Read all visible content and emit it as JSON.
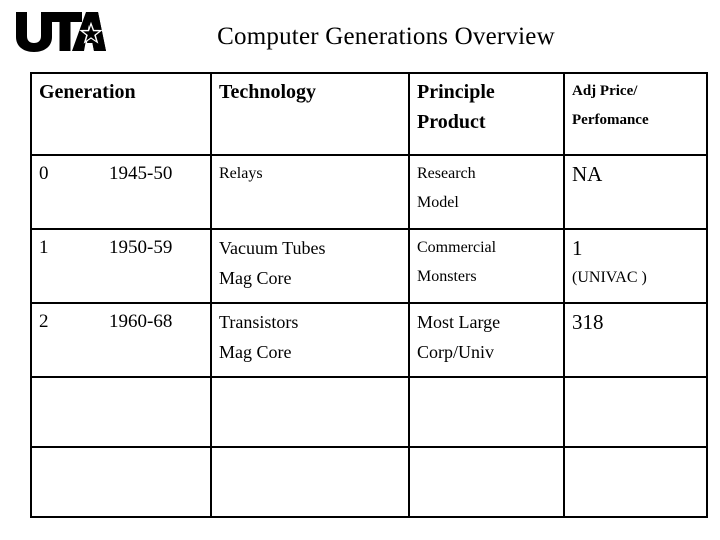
{
  "header": {
    "logo_text": "UTA",
    "logo_icon": "uta-star-logo",
    "title": "Computer Generations Overview"
  },
  "table": {
    "columns": [
      {
        "key": "generation",
        "label": "Generation",
        "size": "big"
      },
      {
        "key": "technology",
        "label": "Technology",
        "size": "big"
      },
      {
        "key": "principle_product",
        "label_line1": "Principle",
        "label_line2": "Product",
        "size": "big"
      },
      {
        "key": "adj_price_performance",
        "label_line1": "Adj Price/",
        "label_line2": "Perfomance",
        "size": "small"
      }
    ],
    "rows": [
      {
        "generation_number": "0",
        "generation_years": "1945-50",
        "technology_line1": "Relays",
        "technology_line2": "",
        "principle_line1": "Research",
        "principle_line2": "Model",
        "price_line1": "NA",
        "price_line2": ""
      },
      {
        "generation_number": "1",
        "generation_years": "1950-59",
        "technology_line1": "Vacuum Tubes",
        "technology_line2": "Mag Core",
        "principle_line1": "Commercial",
        "principle_line2": "Monsters",
        "price_line1": "1",
        "price_line2": "(UNIVAC )"
      },
      {
        "generation_number": "2",
        "generation_years": "1960-68",
        "technology_line1": "Transistors",
        "technology_line2": "Mag Core",
        "principle_line1": "Most Large",
        "principle_line2": "Corp/Univ",
        "price_line1": "318",
        "price_line2": ""
      }
    ],
    "empty_rows": 2
  },
  "colors": {
    "background": "#ffffff",
    "text": "#000000",
    "border": "#000000"
  }
}
